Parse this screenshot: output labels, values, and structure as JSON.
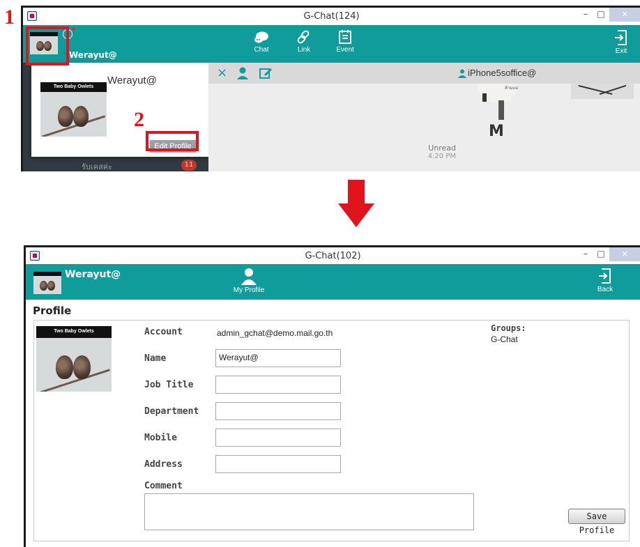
{
  "steps": {
    "one": "1",
    "two": "2"
  },
  "window_top": {
    "title": "G-Chat(124)",
    "username": "Werayut@",
    "toolbar": {
      "chat_label": "Chat",
      "link_label": "Link",
      "event_label": "Event",
      "exit_label": "Exit"
    },
    "popup": {
      "name": "Werayut@",
      "edit_profile_label": "Edit Profile",
      "image_caption": "Two Baby Owlets"
    },
    "chat": {
      "contact": "iPhone5soffice@",
      "unread_label": "Unread",
      "unread_time": "4:20 PM",
      "sticker_text": "ค้ามแม่"
    },
    "list_preview": {
      "text": "รับเคสค่ะ",
      "badge": "11"
    }
  },
  "window_bottom": {
    "title": "G-Chat(102)",
    "username": "Werayut@",
    "toolbar": {
      "my_profile_label": "My Profile",
      "back_label": "Back"
    },
    "section_title": "Profile",
    "image_caption": "Two Baby Owlets",
    "fields": {
      "account_label": "Account",
      "account_value": "admin_gchat@demo.mail.go.th",
      "name_label": "Name",
      "name_value": "Werayut@",
      "job_title_label": "Job Title",
      "job_title_value": "",
      "department_label": "Department",
      "department_value": "",
      "mobile_label": "Mobile",
      "mobile_value": "",
      "address_label": "Address",
      "address_value": "",
      "comment_label": "Comment",
      "comment_value": ""
    },
    "groups_label": "Groups:",
    "groups_value": "G-Chat",
    "save_label": "Save Profile"
  },
  "colors": {
    "teal": "#119c9c",
    "annotation_red": "#e0141c"
  },
  "icons": [
    "app-icon",
    "history-icon",
    "chat-icon",
    "link-icon",
    "event-icon",
    "exit-icon",
    "close-icon",
    "contact-icon",
    "edit-icon",
    "person-icon",
    "back-icon",
    "down-arrow-icon"
  ]
}
